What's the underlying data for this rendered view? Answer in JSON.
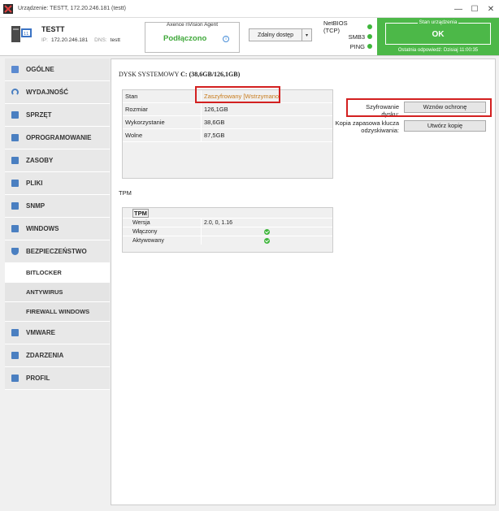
{
  "window": {
    "title": "Urządzenie: TESTT, 172.20.246.181 (testt)",
    "controls": [
      "—",
      "☐",
      "✕"
    ]
  },
  "device": {
    "name": "TESTT",
    "ip_label": "IP:",
    "ip": "172.20.246.181",
    "dns_label": "DNS:",
    "dns": "testt"
  },
  "agent": {
    "title": "Axence nVision Agent",
    "status": "Podłączono",
    "info_icon": "info-icon",
    "status_color": "#3fa83a"
  },
  "remote_access": {
    "label": "Zdalny dostęp",
    "arrow": "▾"
  },
  "protocols": [
    {
      "name": "NetBIOS (TCP)",
      "status": "ok"
    },
    {
      "name": "SMB3",
      "status": "ok"
    },
    {
      "name": "PING",
      "status": "ok"
    }
  ],
  "device_state": {
    "title": "Stan urządzenia",
    "value": "OK",
    "last_response": "Ostatnia odpowiedź: Dzisiaj 11:00:35",
    "color": "#4cb848"
  },
  "sidebar": {
    "items": [
      {
        "label": "OGÓLNE",
        "icon": "general-icon",
        "color": "#4a7fc1"
      },
      {
        "label": "WYDAJNOŚĆ",
        "icon": "performance-icon",
        "color": "#4a7fc1"
      },
      {
        "label": "SPRZĘT",
        "icon": "hardware-icon",
        "color": "#4a7fc1"
      },
      {
        "label": "OPROGRAMOWANIE",
        "icon": "software-icon",
        "color": "#4a7fc1"
      },
      {
        "label": "ZASOBY",
        "icon": "resources-icon",
        "color": "#4a7fc1"
      },
      {
        "label": "PLIKI",
        "icon": "files-icon",
        "color": "#4a7fc1"
      },
      {
        "label": "SNMP",
        "icon": "snmp-icon",
        "color": "#4a7fc1"
      },
      {
        "label": "WINDOWS",
        "icon": "windows-icon",
        "color": "#4a7fc1"
      },
      {
        "label": "BEZPIECZEŃSTWO",
        "icon": "shield-icon",
        "color": "#4a7fc1"
      }
    ],
    "security_sub": [
      {
        "label": "BITLOCKER",
        "active": true
      },
      {
        "label": "ANTYWIRUS",
        "active": false
      },
      {
        "label": "FIREWALL WINDOWS",
        "active": false
      }
    ],
    "bottom_items": [
      {
        "label": "VMWARE",
        "icon": "vmware-icon",
        "color": "#4a7fc1"
      },
      {
        "label": "ZDARZENIA",
        "icon": "events-icon",
        "color": "#4a7fc1"
      },
      {
        "label": "PROFIL",
        "icon": "profile-icon",
        "color": "#4a7fc1"
      }
    ]
  },
  "system_disk": {
    "title_prefix": "DYSK SYSTEMOWY",
    "title_value": "C: (38,6GB/126,1GB)",
    "rows": [
      {
        "key": "Stan",
        "value": "Zaszyfrowany [Wstrzymano]"
      },
      {
        "key": "Rozmiar",
        "value": "126,1GB"
      },
      {
        "key": "Wykorzystanie",
        "value": "38,6GB"
      },
      {
        "key": "Wolne",
        "value": "87,5GB"
      }
    ],
    "encryption_label": "Szyfrowanie dysku:",
    "resume_button": "Wznów ochronę",
    "backup_label_line1": "Kopia zapasowa klucza",
    "backup_label_line2": "odzyskiwania:",
    "backup_button": "Utwórz kopię"
  },
  "tpm": {
    "section_title": "TPM",
    "table_header": "TPM",
    "rows": [
      {
        "key": "Wersja",
        "value": "2.0, 0, 1.16"
      },
      {
        "key": "Włączony",
        "value": ""
      },
      {
        "key": "Aktywowany",
        "value": ""
      }
    ]
  }
}
